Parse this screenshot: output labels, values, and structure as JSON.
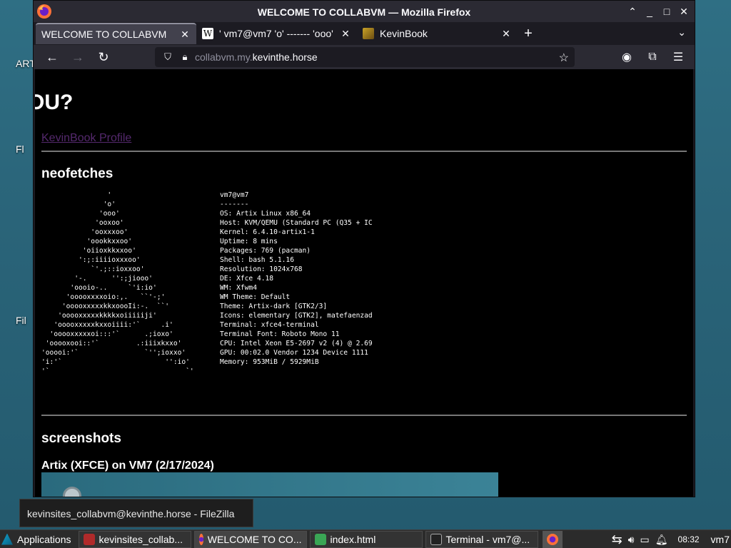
{
  "desktop": {
    "labels": [
      "ART",
      "Fl",
      "Fil"
    ]
  },
  "window": {
    "title": "WELCOME TO COLLABVM — Mozilla Firefox",
    "controls": {
      "minimize": "⌃",
      "restore": "_",
      "maximize": "□",
      "close": "✕"
    }
  },
  "tabs": [
    {
      "label": "WELCOME TO COLLABVM",
      "active": true
    },
    {
      "label": "' vm7@vm7 'o' ------- 'ooo' ",
      "active": false
    },
    {
      "label": "KevinBook",
      "active": false
    }
  ],
  "nav": {
    "url_dim": "collabvm.my.",
    "url_host": "kevinthe.horse"
  },
  "page": {
    "heading_fragment": "ou?",
    "profile_link": "KevinBook Profile",
    "section_neofetch": "neofetches",
    "neofetch_logo": "                '\n               'o'\n              'ooo'\n             'ooxoo'\n            'ooxxxoo'\n           'oookkxxoo'\n          'oiioxkkxxoo'\n         ':;:iiiioxxxoo'\n            `'.;::ioxxoo'\n        '-.      '':;jiooo'\n       'oooio-..     `'i:io'\n      'ooooxxxxoio:,.   ``'-;'\n     'ooooxxxxxkkxoooIi:-.  ``'\n    'ooooxxxxxkkkkxoiiiiiji'\n   'ooooxxxxxkxxoiiii:'`     .i'\n  'ooooxxxxxoi:::'`      .;ioxo'\n 'ooooxooi::'`         .:iiixkxxo'\n'ooooi:'`                `'';ioxxo'\n'i:'`                         '':io'\n'`                                 `'",
    "neofetch_info": "vm7@vm7\n-------\nOS: Artix Linux x86_64\nHost: KVM/QEMU (Standard PC (Q35 + IC\nKernel: 6.4.10-artix1-1\nUptime: 8 mins\nPackages: 769 (pacman)\nShell: bash 5.1.16\nResolution: 1024x768\nDE: Xfce 4.18\nWM: Xfwm4\nWM Theme: Default\nTheme: Artix-dark [GTK2/3]\nIcons: elementary [GTK2], matefaenzad\nTerminal: xfce4-terminal\nTerminal Font: Roboto Mono 11\nCPU: Intel Xeon E5-2697 v2 (4) @ 2.69\nGPU: 00:02.0 Vendor 1234 Device 1111\nMemory: 953MiB / 5929MiB",
    "section_screenshots": "screenshots",
    "screenshot_caption": "Artix (XFCE) on VM7 (2/17/2024)"
  },
  "tooltip": "kevinsites_collabvm@kevinthe.horse - FileZilla",
  "taskbar": {
    "applications": "Applications",
    "tasks": [
      {
        "label": "kevinsites_collab...",
        "color": "#b02a2a"
      },
      {
        "label": "WELCOME TO CO...",
        "color": "#e66000"
      },
      {
        "label": "index.html",
        "color": "#3aa655"
      },
      {
        "label": "Terminal - vm7@...",
        "color": "#222222"
      }
    ],
    "clock": "08:32",
    "user": "vm7"
  },
  "colors": {
    "accent_link": "#55296e",
    "titlebar": "#2b2a33",
    "tab_active": "#42414d"
  }
}
